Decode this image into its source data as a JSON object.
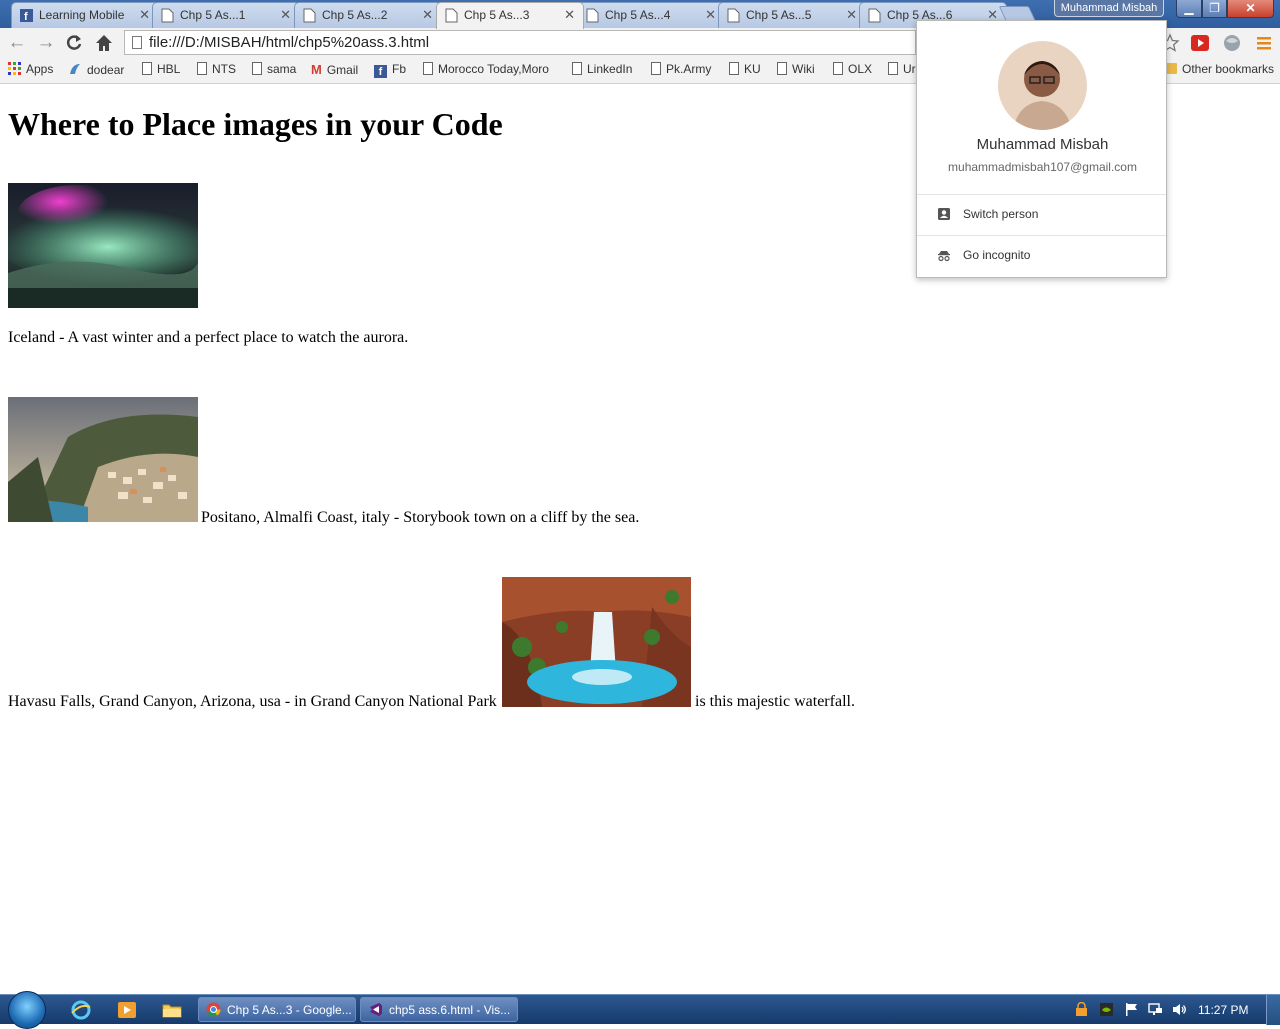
{
  "browser": {
    "tabs": [
      {
        "title": "Learning Mobile",
        "icon": "facebook-icon",
        "active": false
      },
      {
        "title": "Chp 5 As...1",
        "icon": "page-icon",
        "active": false
      },
      {
        "title": "Chp 5 As...2",
        "icon": "page-icon",
        "active": false
      },
      {
        "title": "Chp 5 As...3",
        "icon": "page-icon",
        "active": true
      },
      {
        "title": "Chp 5 As...4",
        "icon": "page-icon",
        "active": false
      },
      {
        "title": "Chp 5 As...5",
        "icon": "page-icon",
        "active": false
      },
      {
        "title": "Chp 5 As...6",
        "icon": "page-icon",
        "active": false
      }
    ],
    "profile_button": "Muhammad Misbah",
    "url": "file:///D:/MISBAH/html/chp5%20ass.3.html",
    "bookmarks": [
      {
        "label": "Apps",
        "icon": "apps-grid-icon"
      },
      {
        "label": "dodear",
        "icon": "dodear-icon"
      },
      {
        "label": "HBL",
        "icon": "page-icon"
      },
      {
        "label": "NTS",
        "icon": "page-icon"
      },
      {
        "label": "sama",
        "icon": "page-icon"
      },
      {
        "label": "Gmail",
        "icon": "gmail-icon"
      },
      {
        "label": "Fb",
        "icon": "facebook-icon"
      },
      {
        "label": "Morocco Today,Moro",
        "icon": "page-icon"
      },
      {
        "label": "LinkedIn",
        "icon": "page-icon"
      },
      {
        "label": "Pk.Army",
        "icon": "page-icon"
      },
      {
        "label": "KU",
        "icon": "page-icon"
      },
      {
        "label": "Wiki",
        "icon": "page-icon"
      },
      {
        "label": "OLX",
        "icon": "page-icon"
      },
      {
        "label": "Ur",
        "icon": "page-icon"
      }
    ],
    "other_bookmarks": "Other bookmarks"
  },
  "page": {
    "heading": "Where to Place images in your Code",
    "iceland_caption": "Iceland - A vast winter and a perfect place to watch the aurora.",
    "positano_caption": "Positano, Almalfi Coast, italy - Storybook town on a cliff by the sea.",
    "havasu_before": "Havasu Falls, Grand Canyon, Arizona, usa - in Grand Canyon National Park",
    "havasu_after": "is this majestic waterfall."
  },
  "profile_popup": {
    "name": "Muhammad Misbah",
    "email": "muhammadmisbah107@gmail.com",
    "switch_person": "Switch person",
    "go_incognito": "Go incognito"
  },
  "taskbar": {
    "tasks": [
      {
        "label": "Chp 5 As...3 - Google...",
        "icon": "chrome-icon"
      },
      {
        "label": "chp5 ass.6.html - Vis...",
        "icon": "visual-studio-icon"
      }
    ],
    "clock": "11:27 PM"
  }
}
